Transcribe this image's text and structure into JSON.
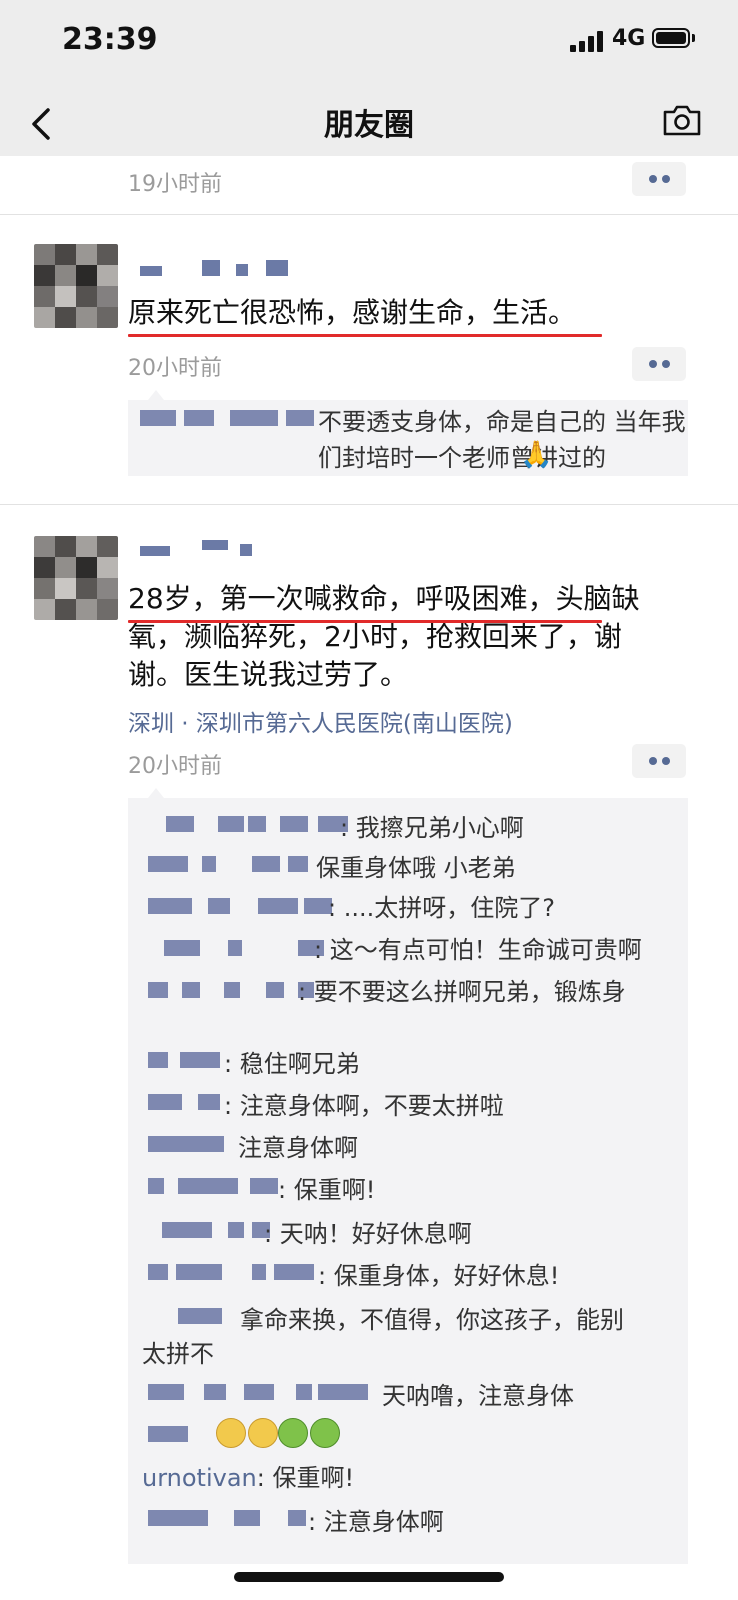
{
  "status_bar": {
    "time": "23:39",
    "network": "4G"
  },
  "nav": {
    "title": "朋友圈"
  },
  "prev_post": {
    "timestamp": "19小时前"
  },
  "post1": {
    "text": "原来死亡很恐怖，感谢生命，生活。",
    "timestamp": "20小时前",
    "comment": "不要透支身体，命是自己的 当年我们封培时一个老师曾讲过的",
    "comment_emoji": "🙏"
  },
  "post2": {
    "text_lines": [
      "28岁，第一次喊救命，呼吸困难，头脑缺",
      "氧，濒临猝死，2小时，抢救回来了，谢",
      "谢。医生说我过劳了。"
    ],
    "location": "深圳 · 深圳市第六人民医院(南山医院)",
    "timestamp": "20小时前",
    "comments": [
      ": 我擦兄弟小心啊",
      "保重身体哦 小老弟",
      ": ....太拼呀，住院了?",
      ": 这～有点可怕！生命诚可贵啊",
      ": 要不要这么拼啊兄弟，锻炼身",
      ": 稳住啊兄弟",
      ": 注意身体啊，不要太拼啦",
      "注意身体啊",
      ": 保重啊!",
      ": 天呐！好好休息啊",
      ": 保重身体，好好休息!",
      "拿命来换，不值得，你这孩子，能别",
      "太拼不",
      "天呐噜，注意身体",
      "urnotivan",
      ": 保重啊!",
      ": 注意身体啊"
    ]
  },
  "colors": {
    "link": "#566a94",
    "underline": "#e12a2a",
    "nav_bg": "#ededed",
    "reply_bg": "#f3f3f5"
  },
  "icons": [
    "back-chevron-icon",
    "camera-icon",
    "more-dots-icon",
    "signal-icon",
    "battery-icon"
  ]
}
